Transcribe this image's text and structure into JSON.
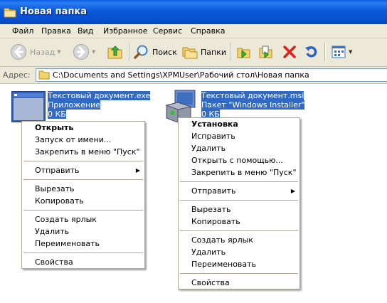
{
  "window": {
    "title": "Новая папка"
  },
  "menubar": {
    "items": [
      "Файл",
      "Правка",
      "Вид",
      "Избранное",
      "Сервис",
      "Справка"
    ]
  },
  "toolbar": {
    "back_label": "Назад",
    "search_label": "Поиск",
    "folders_label": "Папки"
  },
  "address": {
    "label": "Адрес:",
    "path": "C:\\Documents and Settings\\XPMUser\\Рабочий стол\\Новая папка"
  },
  "files": [
    {
      "name": "Текстовый документ.exe",
      "type": "Приложение",
      "size": "0 КБ",
      "icon": "application-exe-icon"
    },
    {
      "name": "Текстовый документ.msi",
      "type": "Пакет \"Windows Installer\"",
      "size": "0 КБ",
      "icon": "windows-installer-package-icon"
    }
  ],
  "context_menu_exe": {
    "items": [
      {
        "label": "Открыть",
        "bold": true
      },
      {
        "label": "Запуск от имени..."
      },
      {
        "label": "Закрепить в меню \"Пуск\""
      },
      {
        "sep": true
      },
      {
        "label": "Отправить",
        "submenu": true
      },
      {
        "sep": true
      },
      {
        "label": "Вырезать"
      },
      {
        "label": "Копировать"
      },
      {
        "sep": true
      },
      {
        "label": "Создать ярлык"
      },
      {
        "label": "Удалить"
      },
      {
        "label": "Переименовать"
      },
      {
        "sep": true
      },
      {
        "label": "Свойства"
      }
    ]
  },
  "context_menu_msi": {
    "items": [
      {
        "label": "Установка",
        "bold": true
      },
      {
        "label": "Исправить"
      },
      {
        "label": "Удалить"
      },
      {
        "label": "Открыть с помощью..."
      },
      {
        "label": "Закрепить в меню \"Пуск\""
      },
      {
        "sep": true
      },
      {
        "label": "Отправить",
        "submenu": true
      },
      {
        "sep": true
      },
      {
        "label": "Вырезать"
      },
      {
        "label": "Копировать"
      },
      {
        "sep": true
      },
      {
        "label": "Создать ярлык"
      },
      {
        "label": "Удалить"
      },
      {
        "label": "Переименовать"
      },
      {
        "sep": true
      },
      {
        "label": "Свойства"
      }
    ]
  },
  "colors": {
    "titlebar": "#0a58d8",
    "chrome": "#ece9d8",
    "selection": "#316ac5",
    "delete_red": "#e0201a"
  }
}
